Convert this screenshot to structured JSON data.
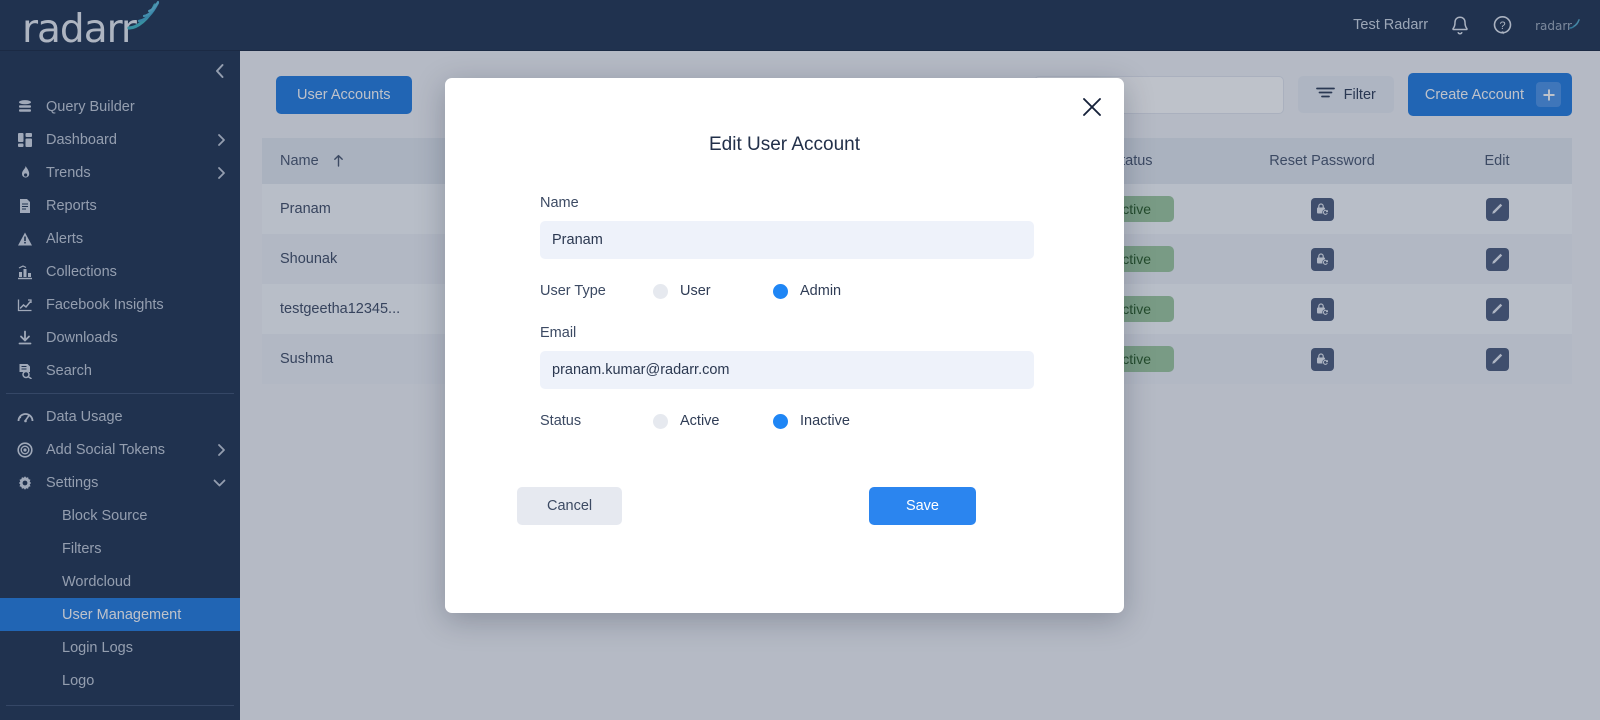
{
  "topbar": {
    "brand": "radarr",
    "user": "Test Radarr",
    "bell_icon": "bell-icon",
    "help_icon": "help-circle-icon",
    "mini_logo": "radarr"
  },
  "sidebar": {
    "collapse_icon": "chevron-left-icon",
    "items": [
      {
        "label": "Query Builder",
        "icon": "database-icon",
        "caret": false
      },
      {
        "label": "Dashboard",
        "icon": "dashboard-grid-icon",
        "caret": true
      },
      {
        "label": "Trends",
        "icon": "flame-icon",
        "caret": true
      },
      {
        "label": "Reports",
        "icon": "document-icon",
        "caret": false
      },
      {
        "label": "Alerts",
        "icon": "warning-triangle-icon",
        "caret": false
      },
      {
        "label": "Collections",
        "icon": "collections-icon",
        "caret": false
      },
      {
        "label": "Facebook Insights",
        "icon": "chart-line-icon",
        "caret": false
      },
      {
        "label": "Downloads",
        "icon": "download-icon",
        "caret": false
      },
      {
        "label": "Search",
        "icon": "search-doc-icon",
        "caret": false
      }
    ],
    "items2": [
      {
        "label": "Data Usage",
        "icon": "gauge-icon",
        "caret": false
      },
      {
        "label": "Add Social Tokens",
        "icon": "target-icon",
        "caret": true
      },
      {
        "label": "Settings",
        "icon": "gear-icon",
        "caret": "down"
      }
    ],
    "subitems": [
      {
        "label": "Block Source",
        "active": false
      },
      {
        "label": "Filters",
        "active": false
      },
      {
        "label": "Wordcloud",
        "active": false
      },
      {
        "label": "User Management",
        "active": true
      },
      {
        "label": "Login Logs",
        "active": false
      },
      {
        "label": "Logo",
        "active": false
      }
    ]
  },
  "content": {
    "tab_label": "User Accounts",
    "search_placeholder": "",
    "search_value": "",
    "filter_label": "Filter",
    "filter_icon": "filter-lines-icon",
    "create_label": "Create Account",
    "create_icon": "plus-icon"
  },
  "table": {
    "columns": [
      "Name",
      "Status",
      "Reset Password",
      "Edit"
    ],
    "sort_icon": "arrow-up-icon",
    "reset_icon": "lock-refresh-icon",
    "edit_icon": "pencil-icon",
    "rows": [
      {
        "name": "Pranam",
        "status": "Active"
      },
      {
        "name": "Shounak",
        "status": "Active"
      },
      {
        "name": "testgeetha12345...",
        "status": "Active"
      },
      {
        "name": "Sushma",
        "status": "Active"
      }
    ]
  },
  "modal": {
    "title": "Edit User Account",
    "close_icon": "close-icon",
    "name_label": "Name",
    "name_value": "Pranam",
    "name_placeholder": "Name",
    "usertype_label": "User Type",
    "usertype_options": [
      {
        "label": "User",
        "selected": false
      },
      {
        "label": "Admin",
        "selected": true
      }
    ],
    "email_label": "Email",
    "email_value": "pranam.kumar@radarr.com",
    "email_placeholder": "Email",
    "status_label": "Status",
    "status_options": [
      {
        "label": "Active",
        "selected": false
      },
      {
        "label": "Inactive",
        "selected": true
      }
    ],
    "cancel_label": "Cancel",
    "save_label": "Save"
  },
  "colors": {
    "sidebar_bg": "#1d3150",
    "accent_blue": "#1f7ae0",
    "radio_blue": "#1f86f5",
    "badge_green_bg": "#9cc79c",
    "badge_green_text": "#23571f",
    "input_bg": "#eef2fa"
  }
}
